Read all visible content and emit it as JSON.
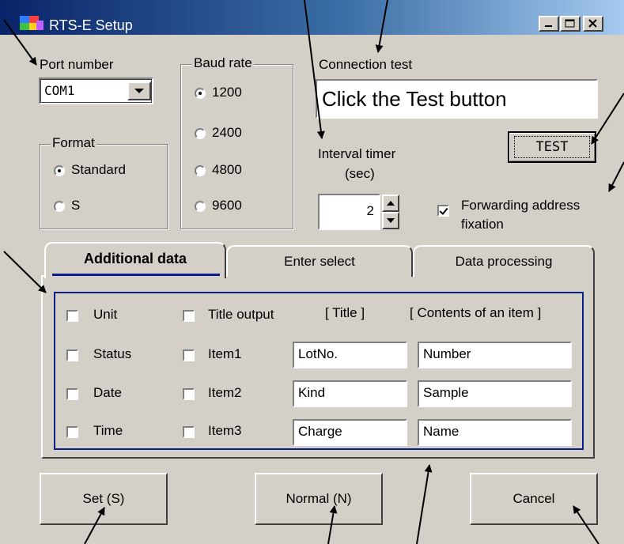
{
  "window": {
    "title": "RTS-E Setup",
    "controls": [
      "minimize",
      "maximize",
      "close"
    ]
  },
  "port": {
    "label": "Port number",
    "value": "COM1"
  },
  "format": {
    "label": "Format",
    "options": [
      {
        "label": "Standard",
        "selected": true
      },
      {
        "label": "S",
        "selected": false
      }
    ]
  },
  "baud": {
    "label": "Baud rate",
    "options": [
      {
        "label": "1200",
        "selected": true
      },
      {
        "label": "2400",
        "selected": false
      },
      {
        "label": "4800",
        "selected": false
      },
      {
        "label": "9600",
        "selected": false
      }
    ]
  },
  "connection": {
    "label": "Connection test",
    "message": "Click the Test button",
    "test_button": "TEST"
  },
  "interval": {
    "label_line1": "Interval timer",
    "label_line2": "(sec)",
    "value": "2"
  },
  "forwarding": {
    "label_line1": "Forwarding address",
    "label_line2": "fixation",
    "checked": true
  },
  "tabs": [
    {
      "label": "Additional data",
      "active": true
    },
    {
      "label": "Enter select",
      "active": false
    },
    {
      "label": "Data processing",
      "active": false
    }
  ],
  "additional": {
    "header_title": "[ Title ]",
    "header_contents": "[ Contents of an item ]",
    "left_checks": [
      "Unit",
      "Status",
      "Date",
      "Time"
    ],
    "title_output": "Title output",
    "items": [
      {
        "label": "Item1",
        "title": "LotNo.",
        "contents": "Number"
      },
      {
        "label": "Item2",
        "title": "Kind",
        "contents": "Sample"
      },
      {
        "label": "Item3",
        "title": "Charge",
        "contents": "Name"
      }
    ]
  },
  "buttons": {
    "set": "Set (S)",
    "normal": "Normal (N)",
    "cancel": "Cancel"
  },
  "colors": {
    "dialog_bg": "#d4d0c8",
    "title_gradient_start": "#0a246a",
    "title_gradient_end": "#a6caf0",
    "inner_border": "#0a1f8a",
    "active_tab_underline": "#0a1f8a"
  }
}
